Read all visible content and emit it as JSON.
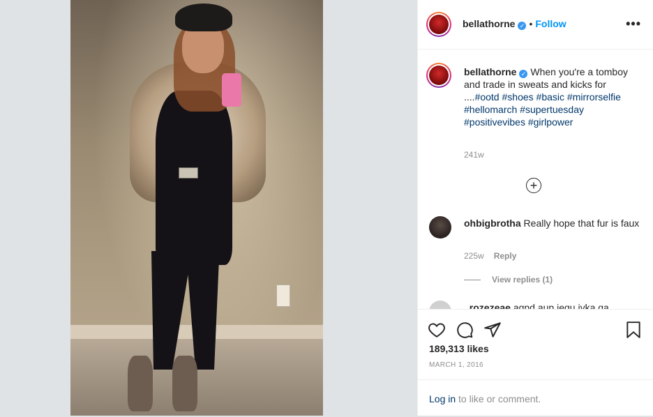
{
  "post": {
    "username": "bellathorne",
    "verified": "✓",
    "follow_separator": "•",
    "follow_label": "Follow",
    "more_label": "•••",
    "caption": {
      "username": "bellathorne",
      "text": "When you're a tomboy and trade in sweats and kicks for ....",
      "hashtags": [
        "#ootd",
        "#shoes",
        "#basic",
        "#mirrorselfie",
        "#hellomarch",
        "#supertuesday",
        "#positivevibes",
        "#girlpower"
      ],
      "time": "241w"
    },
    "load_more_label": "+",
    "comments": [
      {
        "username": "ohbigbrotha",
        "text": "Really hope that fur is faux",
        "time": "225w",
        "reply_label": "Reply",
        "view_replies": "View replies (1)"
      },
      {
        "username": "_rozezeae",
        "text": "agpd aup jequ jyka qa"
      }
    ],
    "likes": "189,313 likes",
    "date": "MARCH 1, 2016",
    "login_link": "Log in",
    "login_text": " to like or comment."
  },
  "icons": [
    "heart-icon",
    "comment-icon",
    "share-icon",
    "bookmark-icon",
    "verified-icon",
    "plus-circle-icon",
    "more-icon"
  ],
  "colors": {
    "accent": "#0095f6",
    "hashtag": "#00376b",
    "muted": "#8e8e8e",
    "text": "#262626"
  }
}
